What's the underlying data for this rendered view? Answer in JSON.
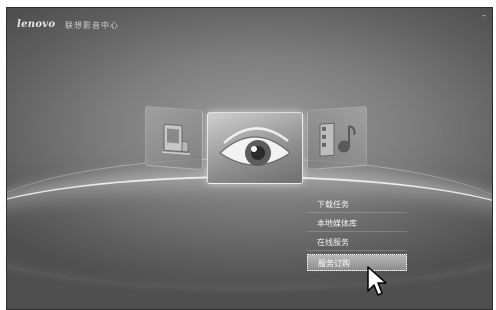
{
  "app": {
    "logo": "lenovo",
    "title": "联想影音中心"
  },
  "window_controls": {
    "minimize": "–",
    "close": "×"
  },
  "carousel": {
    "left_icon": "computer-icon",
    "center_icon": "eye-icon",
    "right_icon": "film-music-icon"
  },
  "menu": {
    "items": [
      {
        "label": "下载任务"
      },
      {
        "label": "本地媒体库"
      },
      {
        "label": "在线服务"
      },
      {
        "label": "服务订购"
      }
    ],
    "active_index": 3
  },
  "colors": {
    "background": "#7d7d7d",
    "highlight": "#ffffff"
  }
}
